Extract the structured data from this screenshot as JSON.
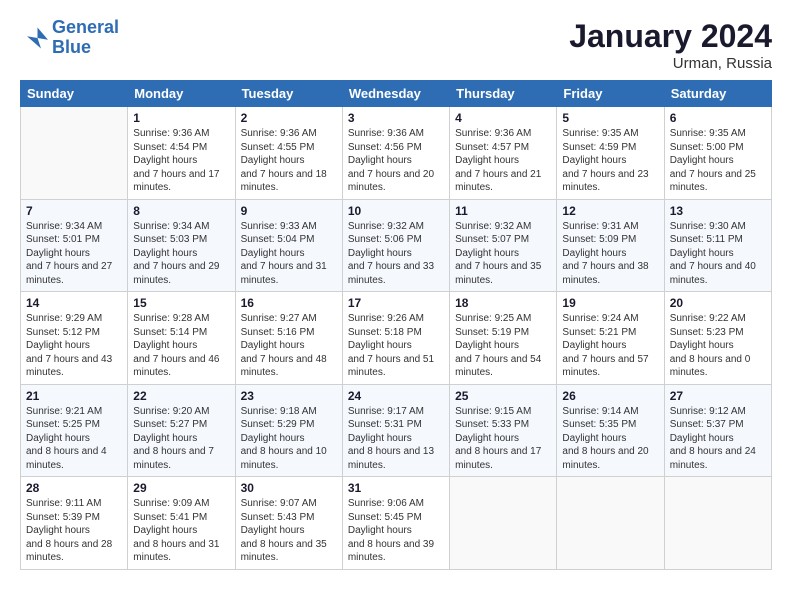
{
  "logo": {
    "line1": "General",
    "line2": "Blue"
  },
  "title": "January 2024",
  "subtitle": "Urman, Russia",
  "days": [
    "Sunday",
    "Monday",
    "Tuesday",
    "Wednesday",
    "Thursday",
    "Friday",
    "Saturday"
  ],
  "weeks": [
    [
      {
        "date": "",
        "sunrise": "",
        "sunset": "",
        "daylight": ""
      },
      {
        "date": "1",
        "sunrise": "9:36 AM",
        "sunset": "4:54 PM",
        "daylight": "7 hours and 17 minutes."
      },
      {
        "date": "2",
        "sunrise": "9:36 AM",
        "sunset": "4:55 PM",
        "daylight": "7 hours and 18 minutes."
      },
      {
        "date": "3",
        "sunrise": "9:36 AM",
        "sunset": "4:56 PM",
        "daylight": "7 hours and 20 minutes."
      },
      {
        "date": "4",
        "sunrise": "9:36 AM",
        "sunset": "4:57 PM",
        "daylight": "7 hours and 21 minutes."
      },
      {
        "date": "5",
        "sunrise": "9:35 AM",
        "sunset": "4:59 PM",
        "daylight": "7 hours and 23 minutes."
      },
      {
        "date": "6",
        "sunrise": "9:35 AM",
        "sunset": "5:00 PM",
        "daylight": "7 hours and 25 minutes."
      }
    ],
    [
      {
        "date": "7",
        "sunrise": "9:34 AM",
        "sunset": "5:01 PM",
        "daylight": "7 hours and 27 minutes."
      },
      {
        "date": "8",
        "sunrise": "9:34 AM",
        "sunset": "5:03 PM",
        "daylight": "7 hours and 29 minutes."
      },
      {
        "date": "9",
        "sunrise": "9:33 AM",
        "sunset": "5:04 PM",
        "daylight": "7 hours and 31 minutes."
      },
      {
        "date": "10",
        "sunrise": "9:32 AM",
        "sunset": "5:06 PM",
        "daylight": "7 hours and 33 minutes."
      },
      {
        "date": "11",
        "sunrise": "9:32 AM",
        "sunset": "5:07 PM",
        "daylight": "7 hours and 35 minutes."
      },
      {
        "date": "12",
        "sunrise": "9:31 AM",
        "sunset": "5:09 PM",
        "daylight": "7 hours and 38 minutes."
      },
      {
        "date": "13",
        "sunrise": "9:30 AM",
        "sunset": "5:11 PM",
        "daylight": "7 hours and 40 minutes."
      }
    ],
    [
      {
        "date": "14",
        "sunrise": "9:29 AM",
        "sunset": "5:12 PM",
        "daylight": "7 hours and 43 minutes."
      },
      {
        "date": "15",
        "sunrise": "9:28 AM",
        "sunset": "5:14 PM",
        "daylight": "7 hours and 46 minutes."
      },
      {
        "date": "16",
        "sunrise": "9:27 AM",
        "sunset": "5:16 PM",
        "daylight": "7 hours and 48 minutes."
      },
      {
        "date": "17",
        "sunrise": "9:26 AM",
        "sunset": "5:18 PM",
        "daylight": "7 hours and 51 minutes."
      },
      {
        "date": "18",
        "sunrise": "9:25 AM",
        "sunset": "5:19 PM",
        "daylight": "7 hours and 54 minutes."
      },
      {
        "date": "19",
        "sunrise": "9:24 AM",
        "sunset": "5:21 PM",
        "daylight": "7 hours and 57 minutes."
      },
      {
        "date": "20",
        "sunrise": "9:22 AM",
        "sunset": "5:23 PM",
        "daylight": "8 hours and 0 minutes."
      }
    ],
    [
      {
        "date": "21",
        "sunrise": "9:21 AM",
        "sunset": "5:25 PM",
        "daylight": "8 hours and 4 minutes."
      },
      {
        "date": "22",
        "sunrise": "9:20 AM",
        "sunset": "5:27 PM",
        "daylight": "8 hours and 7 minutes."
      },
      {
        "date": "23",
        "sunrise": "9:18 AM",
        "sunset": "5:29 PM",
        "daylight": "8 hours and 10 minutes."
      },
      {
        "date": "24",
        "sunrise": "9:17 AM",
        "sunset": "5:31 PM",
        "daylight": "8 hours and 13 minutes."
      },
      {
        "date": "25",
        "sunrise": "9:15 AM",
        "sunset": "5:33 PM",
        "daylight": "8 hours and 17 minutes."
      },
      {
        "date": "26",
        "sunrise": "9:14 AM",
        "sunset": "5:35 PM",
        "daylight": "8 hours and 20 minutes."
      },
      {
        "date": "27",
        "sunrise": "9:12 AM",
        "sunset": "5:37 PM",
        "daylight": "8 hours and 24 minutes."
      }
    ],
    [
      {
        "date": "28",
        "sunrise": "9:11 AM",
        "sunset": "5:39 PM",
        "daylight": "8 hours and 28 minutes."
      },
      {
        "date": "29",
        "sunrise": "9:09 AM",
        "sunset": "5:41 PM",
        "daylight": "8 hours and 31 minutes."
      },
      {
        "date": "30",
        "sunrise": "9:07 AM",
        "sunset": "5:43 PM",
        "daylight": "8 hours and 35 minutes."
      },
      {
        "date": "31",
        "sunrise": "9:06 AM",
        "sunset": "5:45 PM",
        "daylight": "8 hours and 39 minutes."
      },
      {
        "date": "",
        "sunrise": "",
        "sunset": "",
        "daylight": ""
      },
      {
        "date": "",
        "sunrise": "",
        "sunset": "",
        "daylight": ""
      },
      {
        "date": "",
        "sunrise": "",
        "sunset": "",
        "daylight": ""
      }
    ]
  ]
}
